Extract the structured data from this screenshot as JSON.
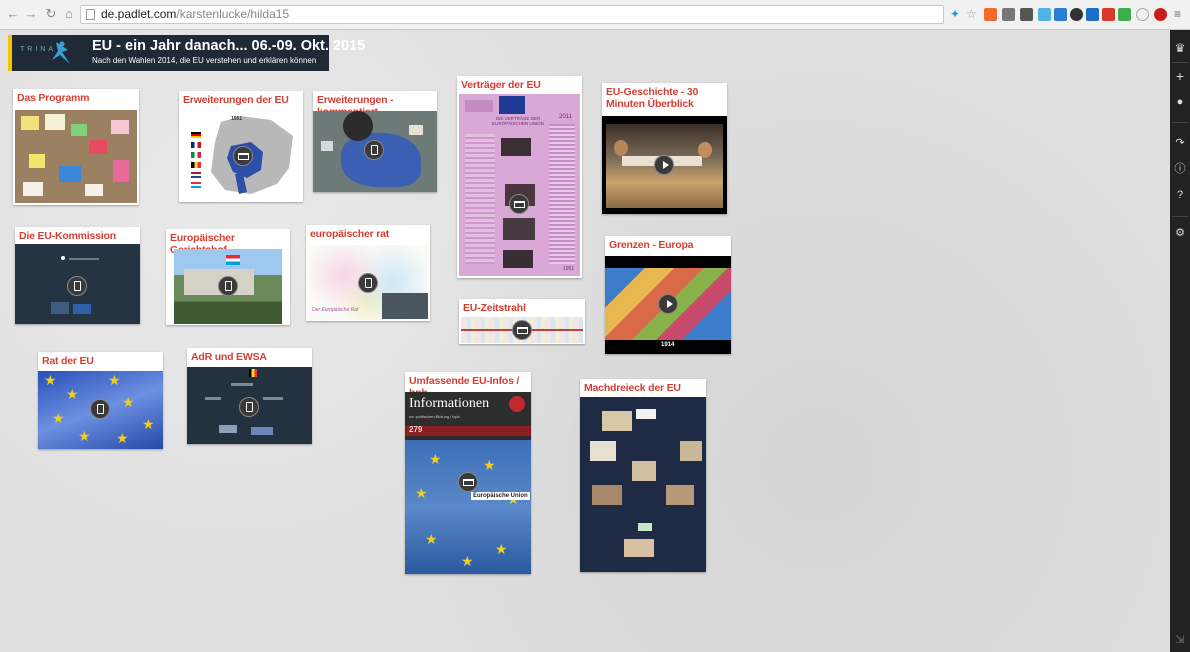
{
  "browser": {
    "url_host": "de.padlet.com",
    "url_path": "/karstenlucke/hilda15"
  },
  "header": {
    "logo_text": "TRINA",
    "title": "EU - ein Jahr danach... 06.-09. Okt. 2015",
    "subtitle": "Nach den Wahlen 2014, die EU verstehen und erklären können"
  },
  "cards": {
    "programm": {
      "title": "Das Programm"
    },
    "erweiterungen": {
      "title": "Erweiterungen der EU",
      "map_year": "1951"
    },
    "kommentiert": {
      "title": "Erweiterungen - kommentiert"
    },
    "vertraege": {
      "title": "Verträger der EU",
      "poster_text": "DIE VERTRÄGE DER EUROPÄISCHEN UNION",
      "poster_year": "2011",
      "poster_bottom": "1951"
    },
    "geschichte": {
      "title": "EU-Geschichte - 30 Minuten Überblick"
    },
    "kommission": {
      "title": "Die EU-Kommission"
    },
    "gerichtshof": {
      "title": "Europäischer Gerichtshof"
    },
    "rat": {
      "title": "europäischer rat",
      "caption": "Der Europäische Rat"
    },
    "zeitstrahl": {
      "title": "EU-Zeitstrahl"
    },
    "grenzen": {
      "title": "Grenzen - Europa",
      "year": "1914"
    },
    "ratdereu": {
      "title": "Rat der EU"
    },
    "adr": {
      "title": "AdR und EWSA"
    },
    "bpb": {
      "title": "Umfassende EU-Infos / bpb",
      "cover_title": "Informationen",
      "cover_sub": "zur politischen Bildung / izpb",
      "issue": "279",
      "cover_label": "Europäische Union"
    },
    "machtdreieck": {
      "title": "Machdreieck der EU"
    }
  },
  "colors": {
    "card_title": "#d43f33",
    "header_bg": "#202a36",
    "header_accent": "#f5c400",
    "sidebar": "#222222"
  }
}
